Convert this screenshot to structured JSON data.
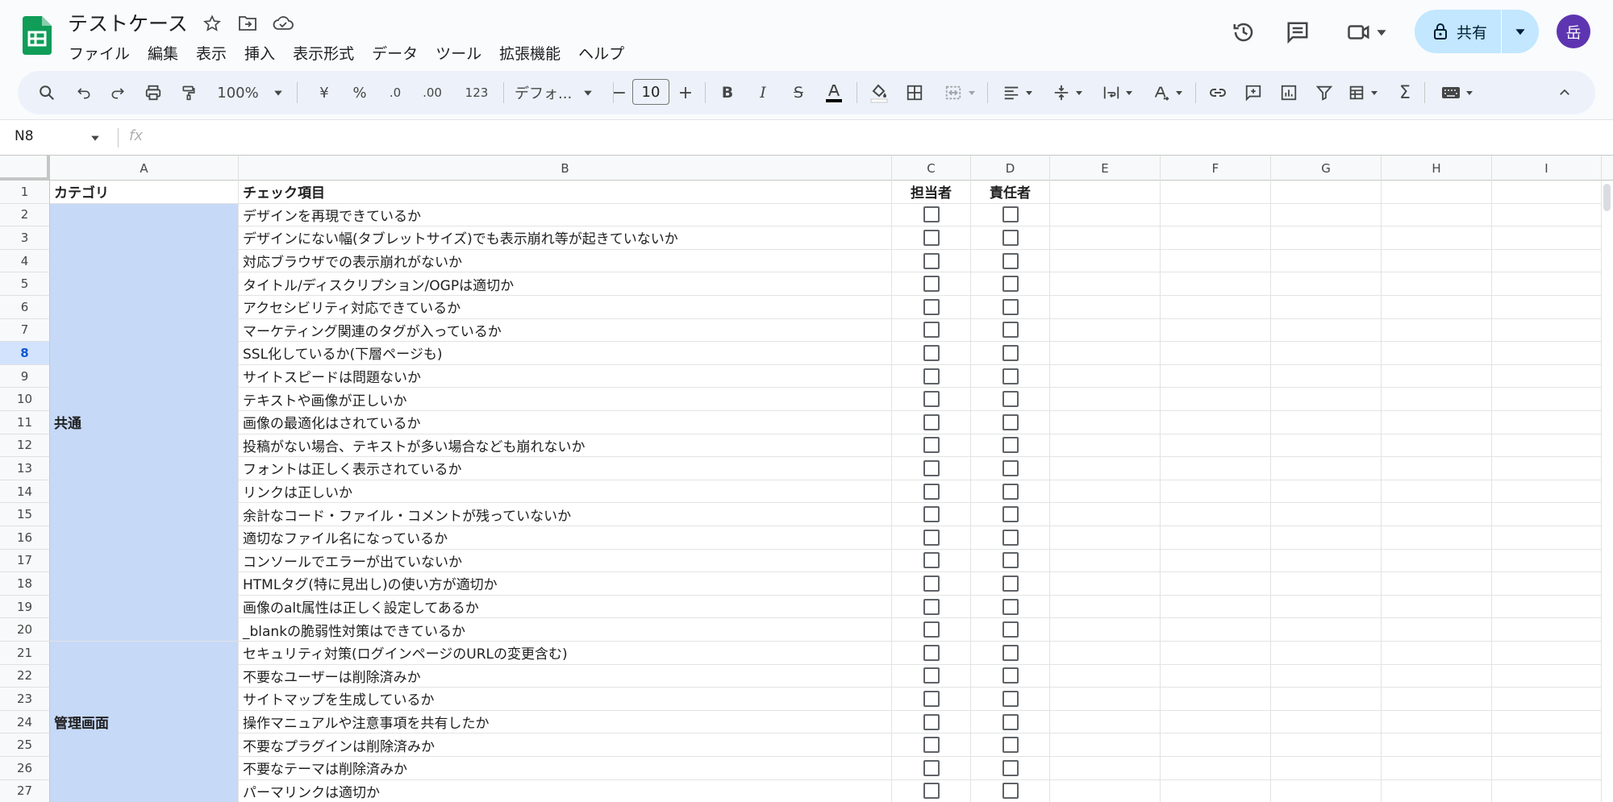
{
  "app": {
    "title": "テストケース",
    "menus": [
      "ファイル",
      "編集",
      "表示",
      "挿入",
      "表示形式",
      "データ",
      "ツール",
      "拡張機能",
      "ヘルプ"
    ],
    "share_label": "共有",
    "avatar_initial": "岳",
    "accent_color": "#c2e7ff",
    "avatar_color": "#5e35b1",
    "logo_color": "#0f9d58"
  },
  "toolbar": {
    "zoom": "100%",
    "currency": "¥",
    "percent": "%",
    "decrease_decimal": ".0",
    "increase_decimal": ".00",
    "number_format": "123",
    "font": "デフォ...",
    "font_size": "10",
    "icons": [
      "search-icon",
      "undo-icon",
      "redo-icon",
      "print-icon",
      "paint-format-icon",
      "bold-icon",
      "italic-icon",
      "strikethrough-icon",
      "text-color-icon",
      "fill-color-icon",
      "borders-icon",
      "merge-icon",
      "align-icon",
      "valign-icon",
      "wrap-icon",
      "rotate-icon",
      "link-icon",
      "comment-icon",
      "chart-icon",
      "filter-icon",
      "table-view-icon",
      "functions-icon",
      "input-tools-icon",
      "collapse-icon"
    ]
  },
  "formula_bar": {
    "name_box": "N8",
    "fx": "fx"
  },
  "grid": {
    "columns": [
      "A",
      "B",
      "C",
      "D",
      "E",
      "F",
      "G",
      "H",
      "I"
    ],
    "active_row": 8,
    "header_row": [
      "カテゴリ",
      "チェック項目",
      "担当者",
      "責任者"
    ],
    "category_fill": "#c6d9f7",
    "categories": [
      {
        "label": "共通",
        "from_row": 2,
        "to_row": 20
      },
      {
        "label": "管理画面",
        "from_row": 21,
        "to_row": 27
      }
    ],
    "items": [
      "デザインを再現できているか",
      "デザインにない幅(タブレットサイズ)でも表示崩れ等が起きていないか",
      "対応ブラウザでの表示崩れがないか",
      "タイトル/ディスクリプション/OGPは適切か",
      "アクセシビリティ対応できているか",
      "マーケティング関連のタグが入っているか",
      "SSL化しているか(下層ページも)",
      "サイトスピードは問題ないか",
      "テキストや画像が正しいか",
      "画像の最適化はされているか",
      "投稿がない場合、テキストが多い場合なども崩れないか",
      "フォントは正しく表示されているか",
      "リンクは正しいか",
      "余計なコード・ファイル・コメントが残っていないか",
      "適切なファイル名になっているか",
      "コンソールでエラーが出ていないか",
      "HTMLタグ(特に見出し)の使い方が適切か",
      "画像のalt属性は正しく設定してあるか",
      "_blankの脆弱性対策はできているか",
      "セキュリティ対策(ログインページのURLの変更含む)",
      "不要なユーザーは削除済みか",
      "サイトマップを生成しているか",
      "操作マニュアルや注意事項を共有したか",
      "不要なプラグインは削除済みか",
      "不要なテーマは削除済みか",
      "パーマリンクは適切か"
    ],
    "row_numbers": [
      "1",
      "2",
      "3",
      "4",
      "5",
      "6",
      "7",
      "8",
      "9",
      "10",
      "11",
      "12",
      "13",
      "14",
      "15",
      "16",
      "17",
      "18",
      "19",
      "20",
      "21",
      "22",
      "23",
      "24",
      "25",
      "26",
      "27"
    ]
  }
}
